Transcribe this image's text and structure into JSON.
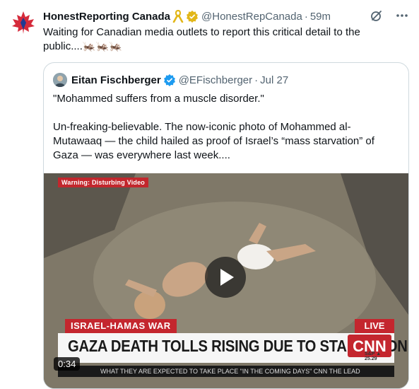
{
  "tweet": {
    "author_name": "HonestReporting Canada",
    "author_handle": "@HonestRepCanada",
    "separator": "·",
    "time": "59m",
    "text": "Waiting for Canadian media outlets to report this critical detail to the public....🦗🦗🦗"
  },
  "quote": {
    "author_name": "Eitan Fischberger",
    "author_handle": "@EFischberger",
    "separator": "·",
    "date": "Jul 27",
    "paragraph1": "\"Mohammed suffers from a muscle disorder.\"",
    "paragraph2": "Un-freaking-believable. The now-iconic photo of Mohammed al-Mutawaaq — the child hailed as proof of Israel’s “mass starvation” of Gaza — was everywhere last week...."
  },
  "video": {
    "warning": "Warning: Disturbing Video",
    "duration": "0:34",
    "lower_third_tag": "ISRAEL-HAMAS WAR",
    "live": "LIVE",
    "headline": "GAZA DEATH TOLLS RISING DUE TO STARVATION",
    "network": "CNN",
    "stock": "S&P ▲ 25.29",
    "ticker": "WHAT THEY ARE EXPECTED TO TAKE PLACE \"IN THE COMING DAYS\"      CNN      THE LEAD"
  },
  "icons": {
    "ribbon": "gold-ribbon-icon",
    "verified": "gold-verified-badge-icon",
    "quote_verified": "blue-verified-badge-icon",
    "grok": "grok-icon",
    "more": "more-icon",
    "play": "play-icon"
  },
  "colors": {
    "text_primary": "#0f1419",
    "text_secondary": "#536471",
    "border": "#cfd9de",
    "verified_blue": "#1d9bf0",
    "verified_gold": "#e2b719",
    "cnn_red": "#c4262e"
  }
}
